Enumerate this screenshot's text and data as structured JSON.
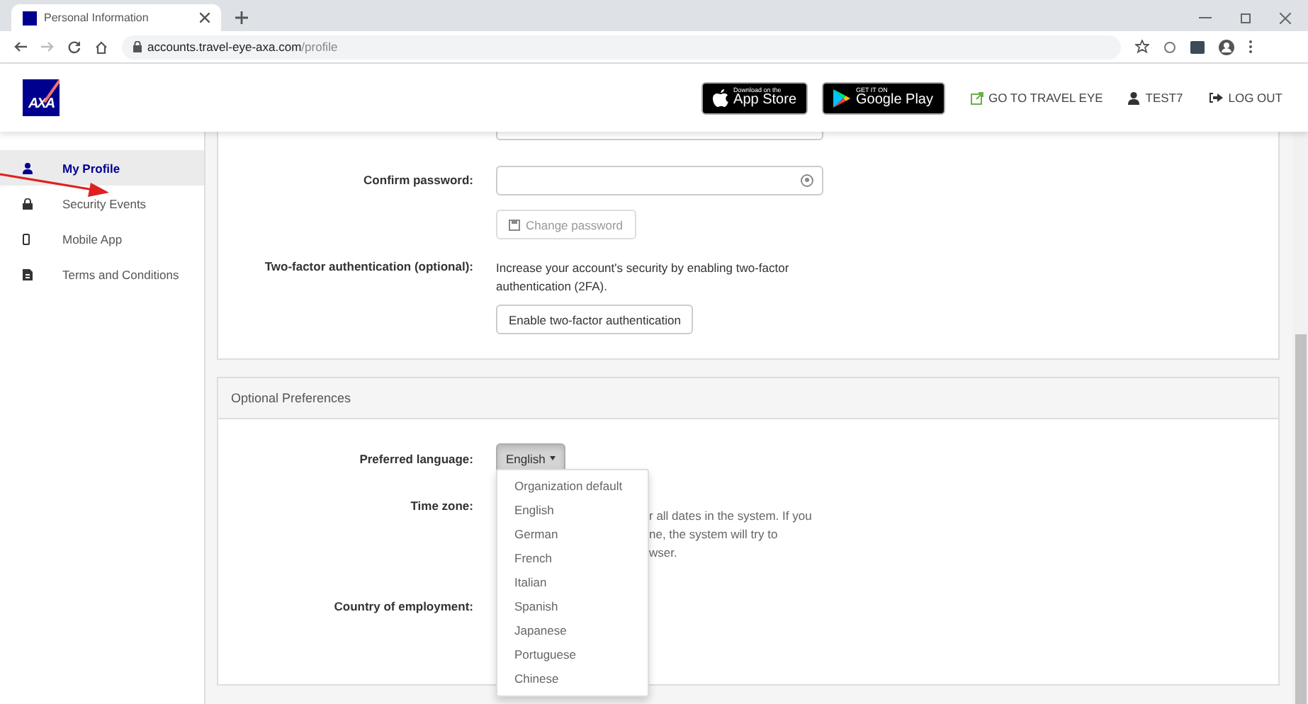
{
  "browser": {
    "tab_title": "Personal Information",
    "url_host": "accounts.travel-eye-axa.com",
    "url_path": "/profile"
  },
  "header": {
    "logo_text": "AXA",
    "store_badges": [
      {
        "kind": "apple",
        "small": "Download on the",
        "big": "App Store"
      },
      {
        "kind": "google",
        "small": "GET IT ON",
        "big": "Google Play"
      }
    ],
    "links": [
      {
        "kind": "external",
        "label": "GO TO TRAVEL EYE"
      },
      {
        "kind": "user",
        "label": "TEST7"
      },
      {
        "kind": "logout",
        "label": "LOG OUT"
      }
    ]
  },
  "sidebar": {
    "items": [
      {
        "label": "My Profile",
        "selected": true
      },
      {
        "label": "Security Events",
        "selected": false
      },
      {
        "label": "Mobile App",
        "selected": false
      },
      {
        "label": "Terms and Conditions",
        "selected": false
      }
    ]
  },
  "password_panel": {
    "confirm_label": "Confirm password:",
    "change_button": "Change password",
    "change_disabled": true,
    "twofa_label": "Two-factor authentication (optional):",
    "twofa_text": "Increase your account's security by enabling two-factor authentication (2FA).",
    "twofa_button": "Enable two-factor authentication"
  },
  "preferences": {
    "title": "Optional Preferences",
    "fields": [
      {
        "kind": "dropdown",
        "label": "Preferred language:",
        "value": "English",
        "expanded": true,
        "options": [
          "Organization default",
          "English",
          "German",
          "French",
          "Italian",
          "Spanish",
          "Japanese",
          "Portuguese",
          "Chinese"
        ]
      },
      {
        "kind": "help",
        "label": "Time zone:",
        "help_lines": [
          "r all dates in the system. If you",
          "ne, the system will try to",
          "wser."
        ]
      },
      {
        "kind": "empty",
        "label": "Country of employment:"
      }
    ]
  }
}
